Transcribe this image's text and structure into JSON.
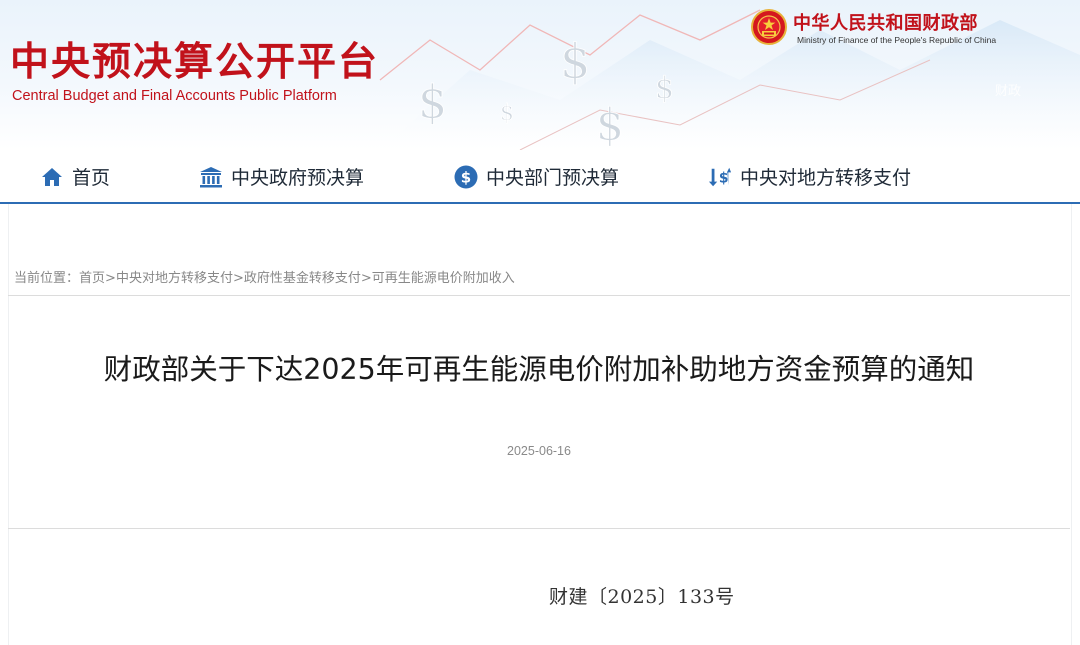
{
  "site": {
    "title_cn": "中央预决算公开平台",
    "title_en": "Central Budget and Final Accounts Public Platform"
  },
  "ministry": {
    "name_cn": "中华人民共和国财政部",
    "name_en": "Ministry of Finance of the People's Republic of China"
  },
  "nav": {
    "items": [
      {
        "label": "首页",
        "icon": "home-icon"
      },
      {
        "label": "中央政府预决算",
        "icon": "government-building-icon"
      },
      {
        "label": "中央部门预决算",
        "icon": "dollar-coin-icon"
      },
      {
        "label": "中央对地方转移支付",
        "icon": "transfer-payment-icon"
      }
    ]
  },
  "breadcrumb": {
    "prefix": "当前位置：",
    "items": [
      "首页",
      "中央对地方转移支付",
      "政府性基金转移支付",
      "可再生能源电价附加收入"
    ],
    "separator": ">"
  },
  "article": {
    "title": "财政部关于下达2025年可再生能源电价附加补助地方资金预算的通知",
    "date": "2025-06-16",
    "doc_number": "财建〔2025〕133号"
  },
  "colors": {
    "brand_red": "#c1121b",
    "nav_blue": "#2c6cb4"
  }
}
